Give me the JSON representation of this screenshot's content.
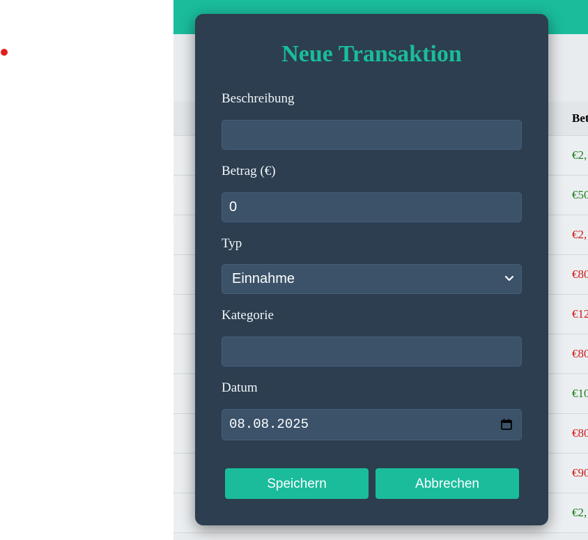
{
  "modal": {
    "title": "Neue Transaktion",
    "fields": {
      "description": {
        "label": "Beschreibung",
        "value": ""
      },
      "amount": {
        "label": "Betrag (€)",
        "value": "0"
      },
      "type": {
        "label": "Typ",
        "value": "Einnahme"
      },
      "category": {
        "label": "Kategorie",
        "value": ""
      },
      "date": {
        "label": "Datum",
        "value": "08.08.2025"
      }
    },
    "buttons": {
      "save": "Speichern",
      "cancel": "Abbrechen"
    }
  },
  "table": {
    "amount_header": "Bet",
    "rows": [
      {
        "amount": "€2,",
        "kind": "income"
      },
      {
        "amount": "€50",
        "kind": "income"
      },
      {
        "amount": "€2,",
        "kind": "expense"
      },
      {
        "amount": "€80",
        "kind": "expense"
      },
      {
        "amount": "€12",
        "kind": "expense"
      },
      {
        "amount": "€80",
        "kind": "expense"
      },
      {
        "amount": "€10",
        "kind": "income"
      },
      {
        "amount": "€80",
        "kind": "expense"
      },
      {
        "amount": "€90",
        "kind": "expense"
      },
      {
        "amount": "€2,",
        "kind": "income"
      }
    ]
  },
  "colors": {
    "accent": "#1abc9c",
    "modal_bg": "#2c3e50",
    "input_bg": "#3b5269",
    "income": "#1a7d1a",
    "expense": "#d01818",
    "marker": "#e02020"
  },
  "icons": {
    "select": "chevron-down-icon",
    "date": "calendar-icon"
  }
}
